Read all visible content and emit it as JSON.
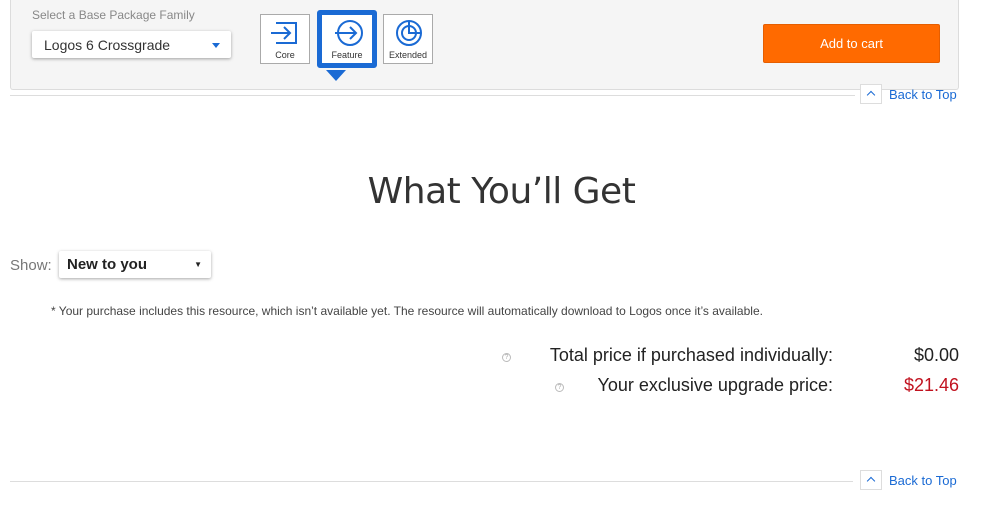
{
  "package_selector": {
    "label": "Select a Base Package Family",
    "selected": "Logos 6 Crossgrade",
    "tiers": [
      {
        "label": "Core",
        "icon": "arrow-into-box-icon"
      },
      {
        "label": "Feature",
        "icon": "arrow-circle-icon",
        "selected": true
      },
      {
        "label": "Extended",
        "icon": "pie-circle-icon"
      }
    ],
    "add_to_cart": "Add to cart"
  },
  "back_to_top": "Back to Top",
  "section": {
    "title": "What You’ll Get",
    "show_label": "Show:",
    "show_value": "New to you",
    "note": "* Your purchase includes this resource, which isn’t available yet. The resource will automatically download to Logos once it’s available."
  },
  "pricing": {
    "individual_label": "Total price if purchased individually:",
    "individual_value": "$0.00",
    "upgrade_label": "Your exclusive upgrade price:",
    "upgrade_value": "$21.46",
    "upgrade_color": "#c1121f"
  },
  "colors": {
    "accent": "#1a6ad4",
    "cart": "#ff6a00"
  }
}
